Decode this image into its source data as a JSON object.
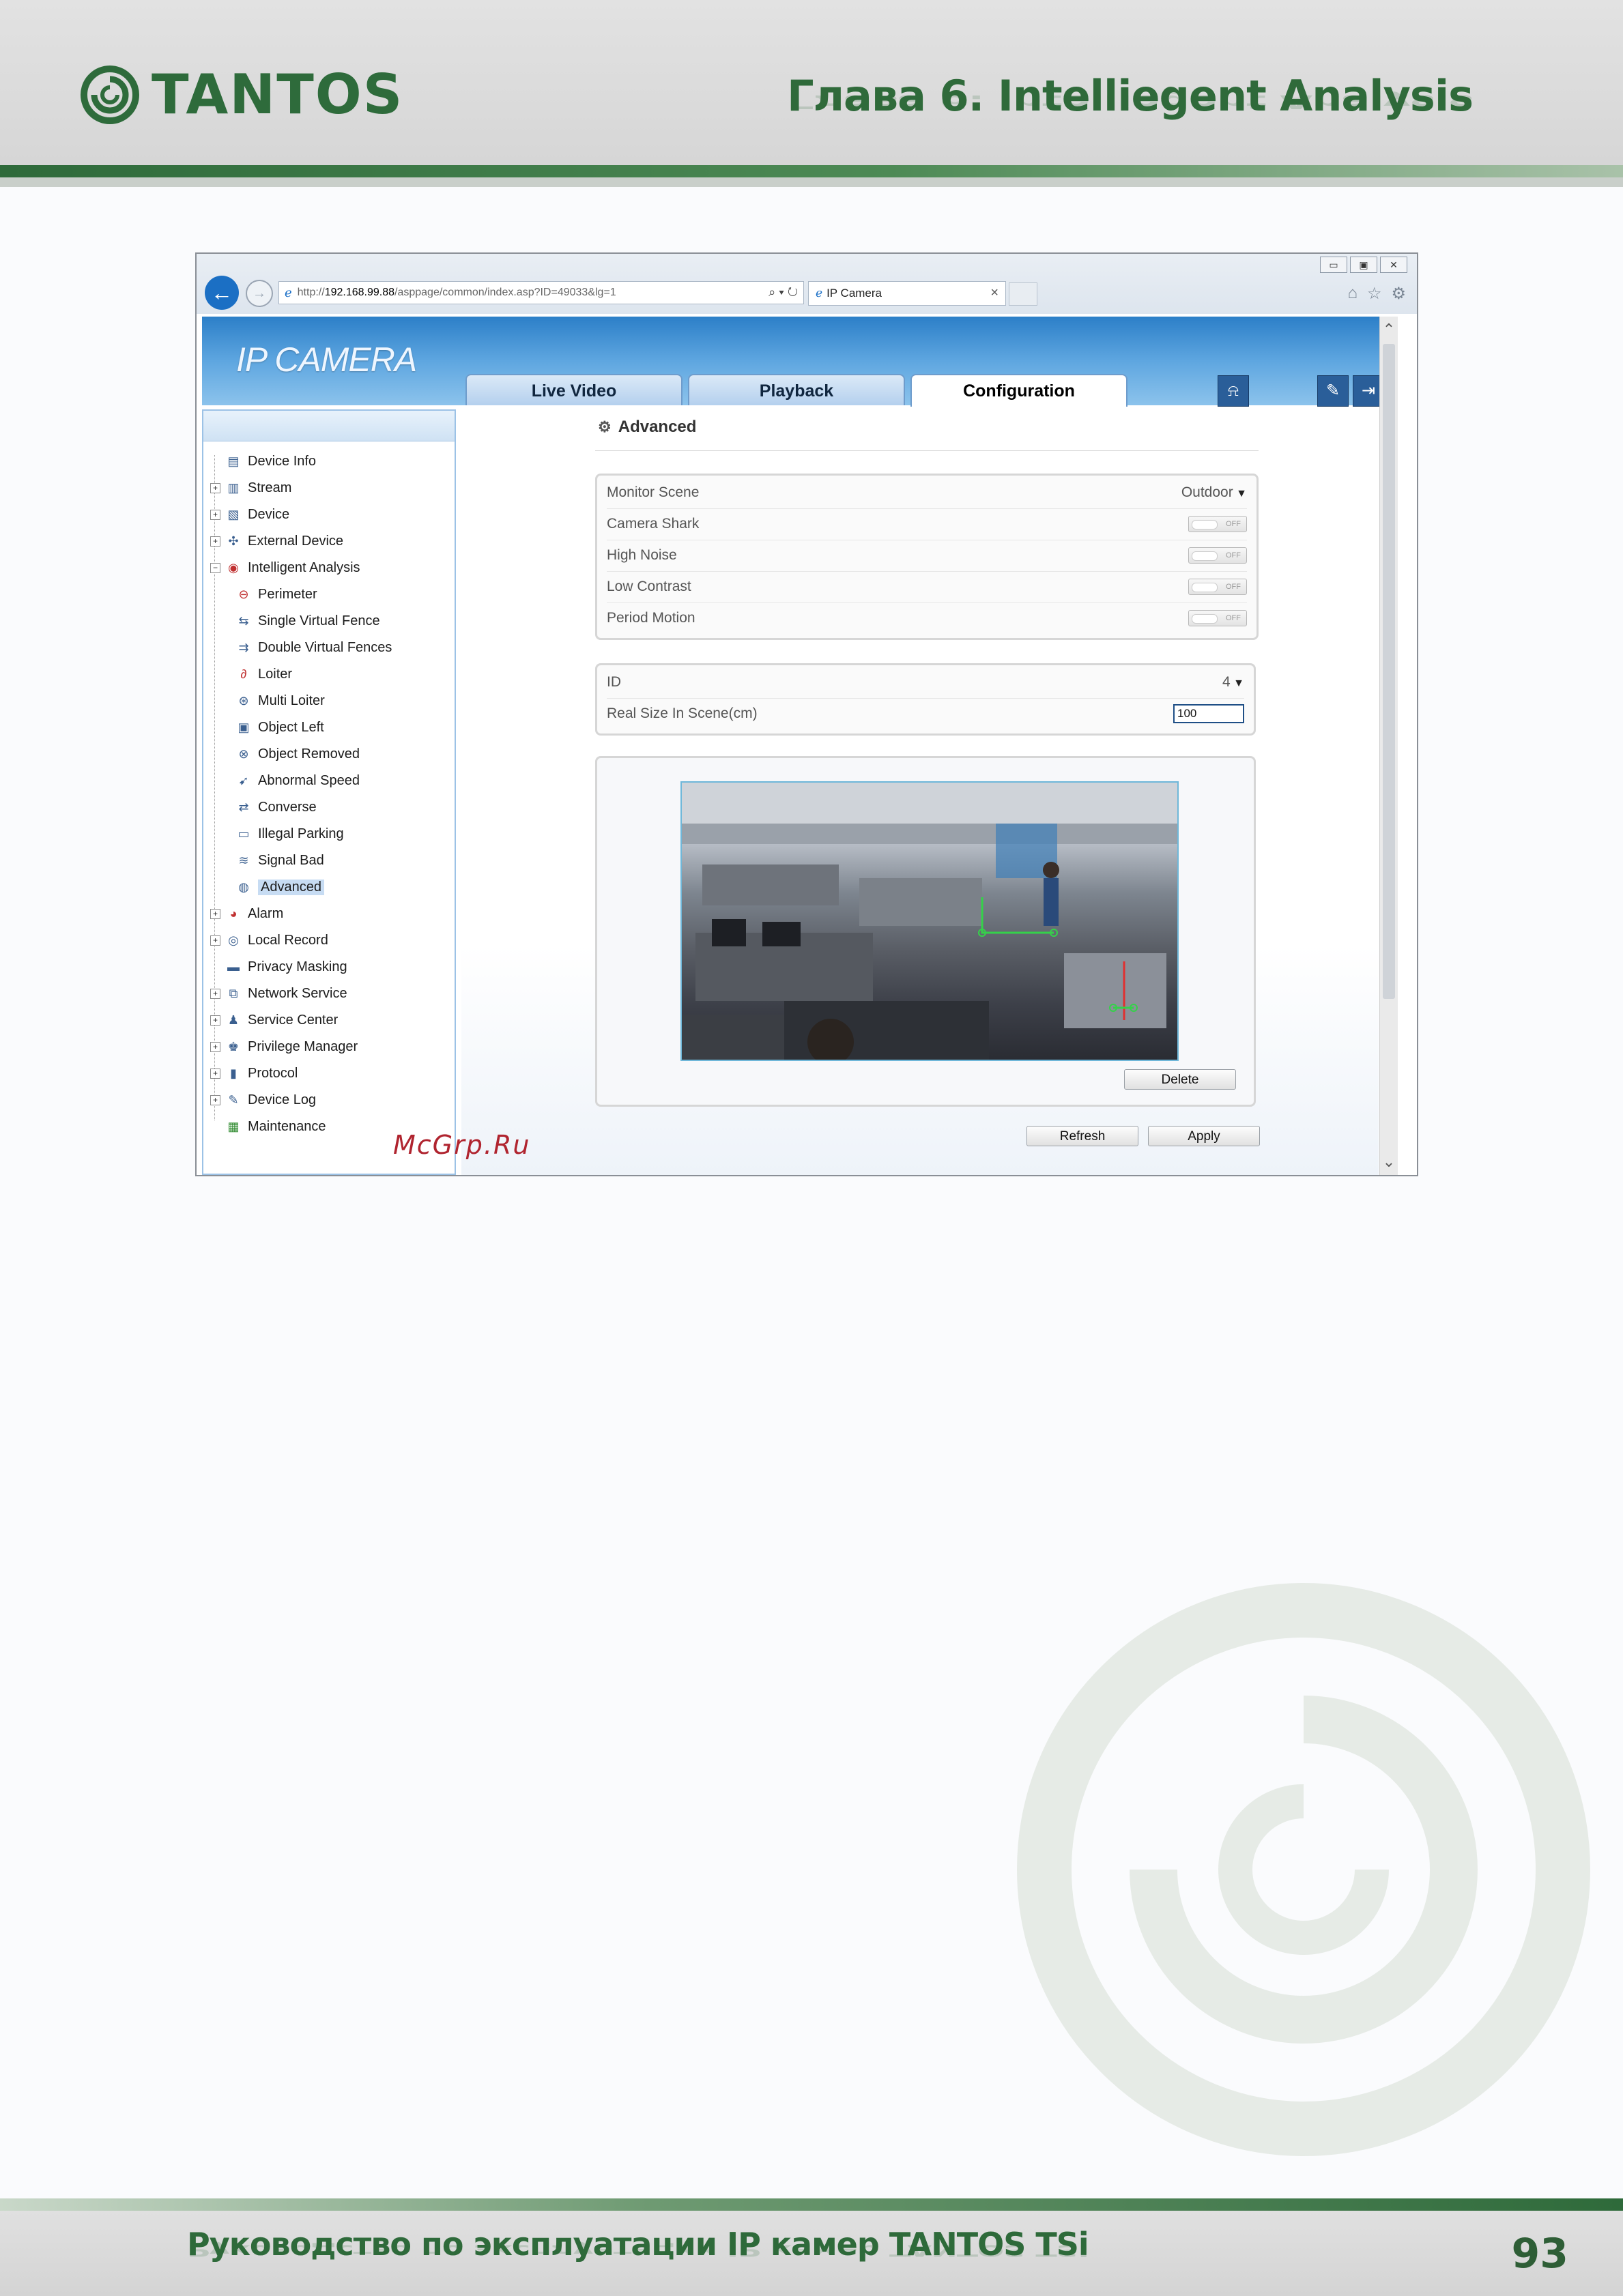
{
  "header": {
    "brand": "TANTOS",
    "chapter_title": "Глава 6. Intelliegent Analysis"
  },
  "browser": {
    "url_prefix": "http://",
    "url_host": "192.168.99.88",
    "url_path": "/asppage/common/index.asp?ID=49033&lg=1",
    "tab_title": "IP Camera"
  },
  "app": {
    "title": "IP CAMERA",
    "tabs": [
      "Live Video",
      "Playback",
      "Configuration"
    ],
    "active_tab": "Configuration"
  },
  "sidebar": {
    "items": [
      {
        "label": "Device Info",
        "icon": "info-icon"
      },
      {
        "label": "Stream",
        "icon": "stream-icon"
      },
      {
        "label": "Device",
        "icon": "device-icon"
      },
      {
        "label": "External Device",
        "icon": "external-device-icon"
      },
      {
        "label": "Intelligent Analysis",
        "icon": "analysis-icon"
      },
      {
        "label": "Perimeter",
        "icon": "perimeter-icon"
      },
      {
        "label": "Single Virtual Fence",
        "icon": "fence-icon"
      },
      {
        "label": "Double Virtual Fences",
        "icon": "double-fence-icon"
      },
      {
        "label": "Loiter",
        "icon": "loiter-icon"
      },
      {
        "label": "Multi Loiter",
        "icon": "multi-loiter-icon"
      },
      {
        "label": "Object Left",
        "icon": "object-left-icon"
      },
      {
        "label": "Object Removed",
        "icon": "object-removed-icon"
      },
      {
        "label": "Abnormal Speed",
        "icon": "speed-icon"
      },
      {
        "label": "Converse",
        "icon": "converse-icon"
      },
      {
        "label": "Illegal Parking",
        "icon": "parking-icon"
      },
      {
        "label": "Signal Bad",
        "icon": "signal-icon"
      },
      {
        "label": "Advanced",
        "icon": "advanced-icon"
      },
      {
        "label": "Alarm",
        "icon": "alarm-icon"
      },
      {
        "label": "Local Record",
        "icon": "record-icon"
      },
      {
        "label": "Privacy Masking",
        "icon": "privacy-icon"
      },
      {
        "label": "Network Service",
        "icon": "network-icon"
      },
      {
        "label": "Service Center",
        "icon": "service-icon"
      },
      {
        "label": "Privilege Manager",
        "icon": "privilege-icon"
      },
      {
        "label": "Protocol",
        "icon": "protocol-icon"
      },
      {
        "label": "Device Log",
        "icon": "log-icon"
      },
      {
        "label": "Maintenance",
        "icon": "maintenance-icon"
      }
    ],
    "selected": "Advanced"
  },
  "content": {
    "title": "Advanced",
    "scene_panel": {
      "monitor_scene_label": "Monitor Scene",
      "monitor_scene_value": "Outdoor",
      "toggles": [
        {
          "label": "Camera Shark",
          "state": "OFF"
        },
        {
          "label": "High Noise",
          "state": "OFF"
        },
        {
          "label": "Low Contrast",
          "state": "OFF"
        },
        {
          "label": "Period Motion",
          "state": "OFF"
        }
      ]
    },
    "size_panel": {
      "id_label": "ID",
      "id_value": "4",
      "real_size_label": "Real Size In Scene(cm)",
      "real_size_value": "100"
    },
    "delete_label": "Delete",
    "refresh_label": "Refresh",
    "apply_label": "Apply"
  },
  "watermark": "McGrp.Ru",
  "footer": {
    "text": "Руководство по эксплуатации IP камер TANTOS TSi",
    "page_number": "93"
  },
  "colors": {
    "brand_green": "#2e6a3a",
    "app_blue": "#2c7fc8",
    "watermark_red": "#b0242f"
  }
}
